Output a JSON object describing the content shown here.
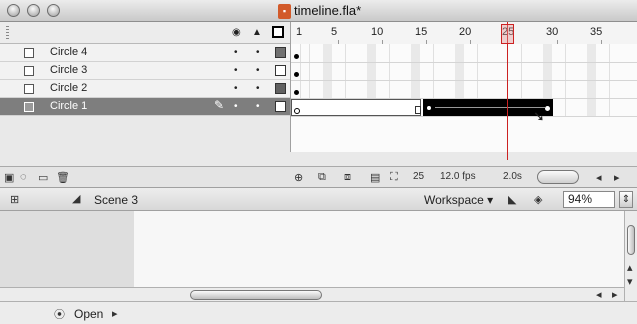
{
  "window": {
    "title": "timeline.fla*",
    "doc_icon": "fla-document-icon",
    "doc_icon_glyph": "▪"
  },
  "timeline": {
    "ruler": [
      "1",
      "5",
      "10",
      "15",
      "20",
      "25",
      "30",
      "35"
    ],
    "layers": [
      {
        "name": "Circle 4",
        "color": "#707070",
        "selected": false
      },
      {
        "name": "Circle 3",
        "color": "#ffffff",
        "selected": false
      },
      {
        "name": "Circle 2",
        "color": "#606060",
        "selected": false
      },
      {
        "name": "Circle 1",
        "color": "#ffffff",
        "selected": true
      }
    ],
    "dot": "•",
    "status": {
      "frame": "25",
      "fps": "12.0 fps",
      "time": "2.0s"
    }
  },
  "editbar": {
    "scene": "Scene 3",
    "workspace": "Workspace ▾",
    "zoom": "94%"
  },
  "footer": {
    "open_label": "Open"
  }
}
